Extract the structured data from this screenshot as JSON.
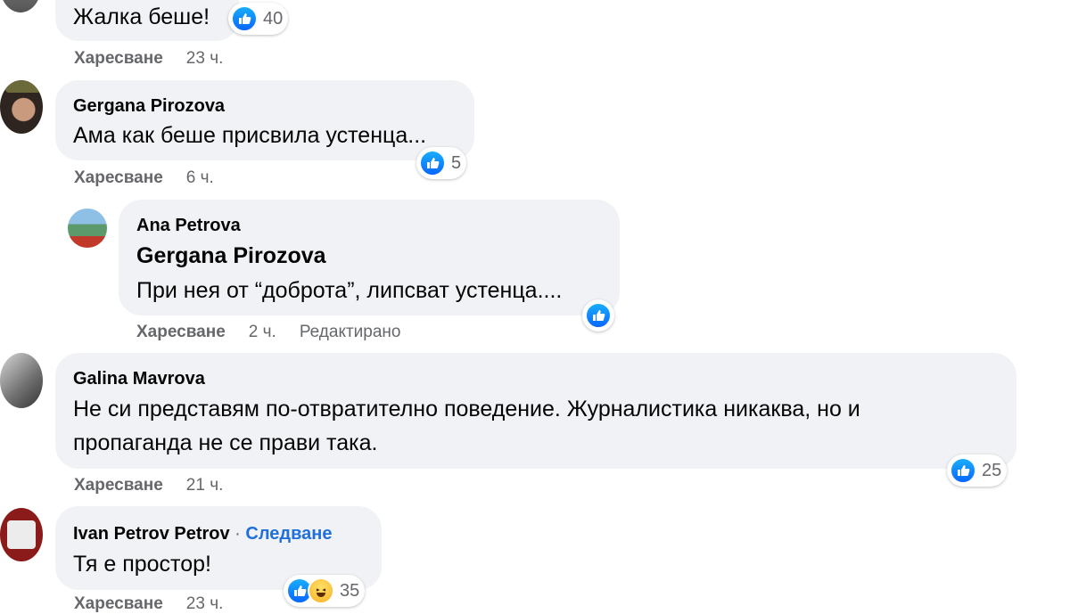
{
  "comments": [
    {
      "text": "Жалка беше!",
      "like_label": "Харесване",
      "time": "23 ч.",
      "reactions": "40"
    },
    {
      "author": "Gergana Pirozova",
      "text": "Ама как беше присвила устенца...",
      "like_label": "Харесване",
      "time": "6 ч.",
      "reactions": "5"
    },
    {
      "author": "Ana Petrova",
      "mention": "Gergana Pirozova",
      "text": "При нея от “доброта”, липсват устенца....",
      "like_label": "Харесване",
      "time": "2 ч.",
      "edited": "Редактирано"
    },
    {
      "author": "Galina Mavrova",
      "text_line1": "Не си представям по-отвратително поведение. Журналистика никаква, но и",
      "text_line2": "пропаганда не се прави така.",
      "like_label": "Харесване",
      "time": "21 ч.",
      "reactions": "25"
    },
    {
      "author": "Ivan Petrov Petrov",
      "follow": "Следване",
      "text": "Тя е простор!",
      "like_label": "Харесване",
      "time": "23 ч.",
      "reactions": "35"
    }
  ],
  "colors": {
    "bubble": "#f0f2f5",
    "like_blue": "#0866ff",
    "meta_gray": "#65676b",
    "follow_blue": "#216fdb"
  },
  "icons": [
    "like-icon",
    "haha-icon"
  ]
}
